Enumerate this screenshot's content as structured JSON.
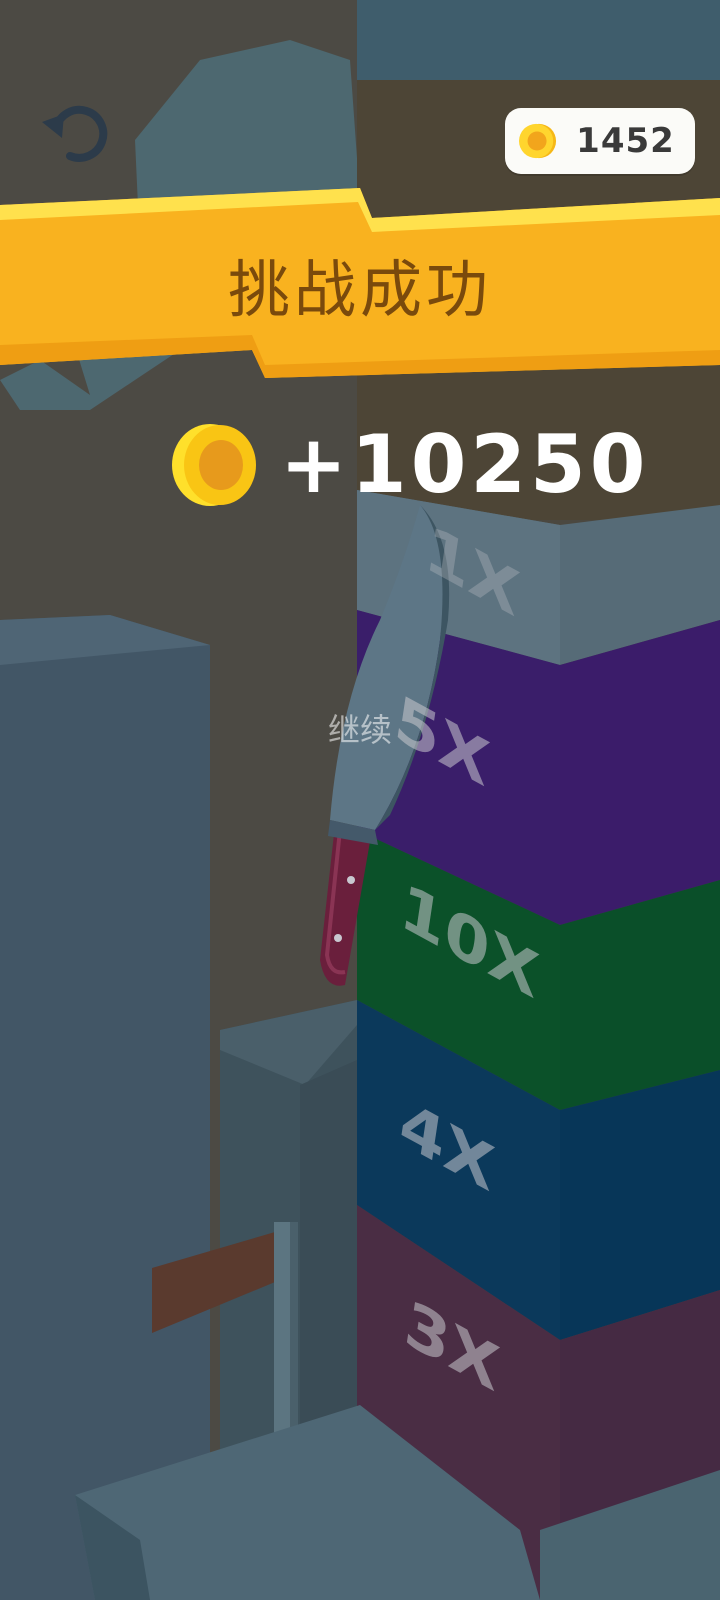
{
  "hud": {
    "coin_balance": "1452",
    "restart_icon": "undo-arrow-icon",
    "coin_icon": "coin-icon"
  },
  "result": {
    "title": "挑战成功",
    "reward": "+10250",
    "continue_label": "继续"
  },
  "tower": {
    "multipliers": [
      "1X",
      "5X",
      "10X",
      "4X",
      "3X"
    ]
  },
  "colors": {
    "banner": "#f9b21f",
    "coin": "#ffd52e",
    "purple_block": "#3a1e6a",
    "green_block": "#0b5129",
    "blue_block": "#0b395b",
    "maroon_block": "#4a2d44"
  }
}
